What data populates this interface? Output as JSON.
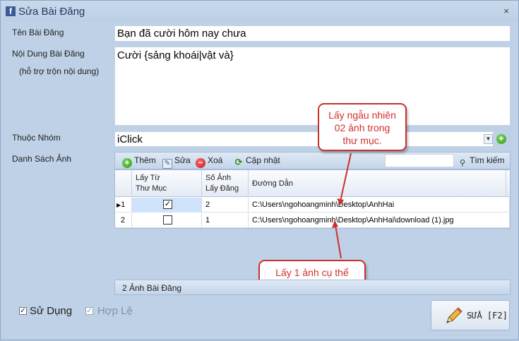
{
  "window": {
    "title": "Sửa Bài Đăng",
    "close": "×"
  },
  "form": {
    "title_label": "Tên Bài Đăng",
    "title_value": "Bạn đã cười hôm nay chưa",
    "content_label": "Nội Dung Bài Đăng",
    "content_hint": "(hỗ trợ trộn nội dung)",
    "content_value": "Cười {sảng khoái|vật và}",
    "group_label": "Thuộc Nhóm",
    "group_value": "iClick",
    "images_label": "Danh Sách Ảnh"
  },
  "toolbar": {
    "add": "Thêm",
    "edit": "Sửa",
    "delete": "Xoá",
    "update": "Cập nhật",
    "search": "Tìm kiếm"
  },
  "grid": {
    "headers": [
      "Lấy Từ\nThư Mục",
      "Số Ảnh\nLấy Đăng",
      "Đường Dẫn"
    ],
    "rows": [
      {
        "num": "1",
        "from_folder": true,
        "count": "2",
        "path": "C:\\Users\\ngohoangminh\\Desktop\\AnhHai"
      },
      {
        "num": "2",
        "from_folder": false,
        "count": "1",
        "path": "C:\\Users\\ngohoangminh\\Desktop\\AnhHai\\download (1).jpg"
      }
    ]
  },
  "callouts": {
    "random": "Lấy ngẫu nhiên\n02 ảnh trong\nthư mục.",
    "specific": "Lấy 1 ảnh cụ thể"
  },
  "panel": {
    "label": "2 Ảnh Bài Đăng"
  },
  "footer": {
    "use_label": "Sử Dụng",
    "valid_label": "Hợp Lệ",
    "save_label": "SỬA [F2]"
  },
  "colors": {
    "callout_border": "#c8312f",
    "callout_text": "#d0302c",
    "window_bg": "#bfd1e6"
  },
  "icons": [
    "facebook-icon",
    "close-icon",
    "add-icon",
    "edit-icon",
    "delete-icon",
    "refresh-icon",
    "binoculars-icon",
    "pencil-icon",
    "chevron-down-icon"
  ]
}
